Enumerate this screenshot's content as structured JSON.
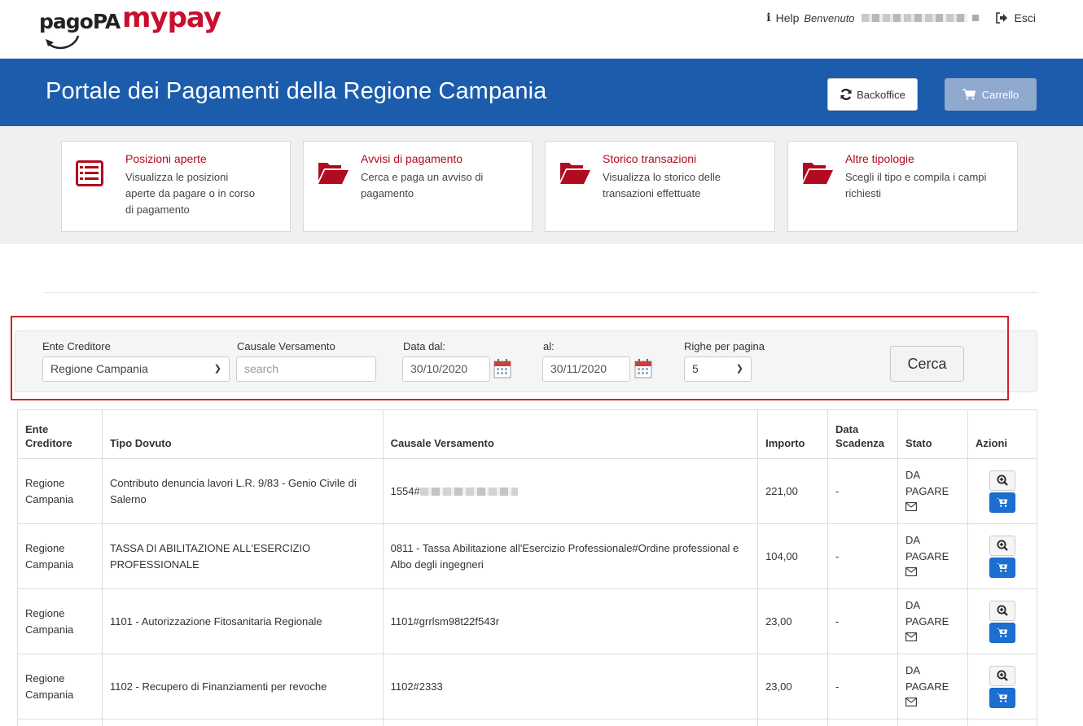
{
  "topbar": {
    "logo_pagopa": "pagoPA",
    "logo_mypay": "mypay",
    "help_label": "Help",
    "welcome_label": "Benvenuto",
    "logout_label": "Esci"
  },
  "header": {
    "title": "Portale dei Pagamenti della Regione Campania",
    "backoffice_label": "Backoffice",
    "carrello_label": "Carrello"
  },
  "tiles": [
    {
      "title": "Posizioni aperte",
      "desc": "Visualizza le posizioni aperte da pagare o in corso di pagamento",
      "icon": "list-icon"
    },
    {
      "title": "Avvisi di pagamento",
      "desc": "Cerca e paga un avviso di pagamento",
      "icon": "folder-open-icon"
    },
    {
      "title": "Storico transazioni",
      "desc": "Visualizza lo storico delle transazioni effettuate",
      "icon": "folder-open-icon"
    },
    {
      "title": "Altre tipologie",
      "desc": "Scegli il tipo e compila i campi richiesti",
      "icon": "folder-open-icon"
    }
  ],
  "filter": {
    "ente_label": "Ente Creditore",
    "ente_value": "Regione Campania",
    "causale_label": "Causale Versamento",
    "causale_placeholder": "search",
    "data_dal_label": "Data dal:",
    "data_dal_value": "30/10/2020",
    "al_label": "al:",
    "al_value": "30/11/2020",
    "righe_label": "Righe per pagina",
    "righe_value": "5",
    "cerca_label": "Cerca"
  },
  "table": {
    "headers": {
      "ente_line1": "Ente",
      "ente_line2": "Creditore",
      "tipo": "Tipo Dovuto",
      "causale": "Causale Versamento",
      "importo": "Importo",
      "data_line1": "Data",
      "data_line2": "Scadenza",
      "stato": "Stato",
      "azioni": "Azioni"
    },
    "rows": [
      {
        "ente_line1": "Regione",
        "ente_line2": "Campania",
        "tipo": "Contributo denuncia lavori L.R. 9/83 - Genio Civile di Salerno",
        "causale": "1554#",
        "importo": "221,00",
        "scadenza": "-",
        "stato_line1": "DA",
        "stato_line2": "PAGARE"
      },
      {
        "ente_line1": "Regione",
        "ente_line2": "Campania",
        "tipo": "TASSA DI ABILITAZIONE ALL'ESERCIZIO PROFESSIONALE",
        "causale": "0811 - Tassa Abilitazione all'Esercizio Professionale#Ordine professional e Albo degli ingegneri",
        "importo": "104,00",
        "scadenza": "-",
        "stato_line1": "DA",
        "stato_line2": "PAGARE"
      },
      {
        "ente_line1": "Regione",
        "ente_line2": "Campania",
        "tipo": "1101 - Autorizzazione Fitosanitaria Regionale",
        "causale": "1101#grrlsm98t22f543r",
        "importo": "23,00",
        "scadenza": "-",
        "stato_line1": "DA",
        "stato_line2": "PAGARE"
      },
      {
        "ente_line1": "Regione",
        "ente_line2": "Campania",
        "tipo": "1102 - Recupero di Finanziamenti per revoche",
        "causale": "1102#2333",
        "importo": "23,00",
        "scadenza": "-",
        "stato_line1": "DA",
        "stato_line2": "PAGARE"
      }
    ]
  },
  "colors": {
    "header_blue": "#1c5cad",
    "accent_red": "#b00b1e",
    "cart_button_blue": "#1c6fd1",
    "highlight_red": "#d4212e"
  }
}
